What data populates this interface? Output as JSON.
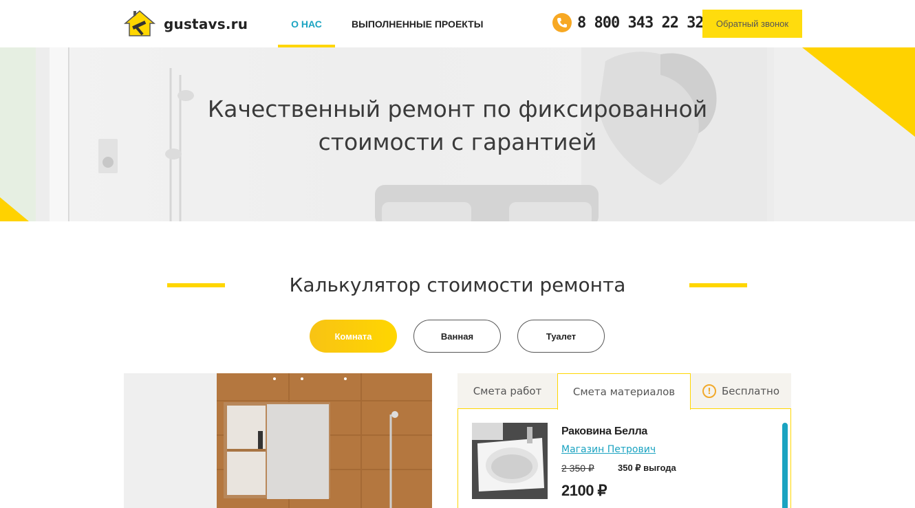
{
  "header": {
    "logo_text": "gustavs.ru",
    "nav": [
      {
        "label": "О НАС",
        "active": true
      },
      {
        "label": "ВЫПОЛНЕННЫЕ ПРОЕКТЫ",
        "active": false
      }
    ],
    "phone": "8 800 343 22 32",
    "callback_label": "Обратный звонок"
  },
  "hero": {
    "title_line1": "Качественный ремонт по фиксированной",
    "title_line2": "стоимости с гарантией"
  },
  "calculator": {
    "title": "Калькулятор стоимости ремонта",
    "rooms": [
      {
        "label": "Комната",
        "active": true
      },
      {
        "label": "Ванная",
        "active": false
      },
      {
        "label": "Туалет",
        "active": false
      }
    ],
    "tabs": [
      {
        "label": "Смета работ",
        "active": false
      },
      {
        "label": "Смета материалов",
        "active": true
      },
      {
        "label": "Бесплатно",
        "active": false
      }
    ],
    "product": {
      "name": "Раковина Белла",
      "shop": "Магазин Петрович",
      "old_price": "2 350 ₽",
      "saving": "350 ₽ выгода",
      "price": "2100 ₽"
    }
  },
  "colors": {
    "accent_yellow": "#ffd600",
    "accent_blue": "#1aa3c1",
    "phone_orange": "#f7a823"
  }
}
